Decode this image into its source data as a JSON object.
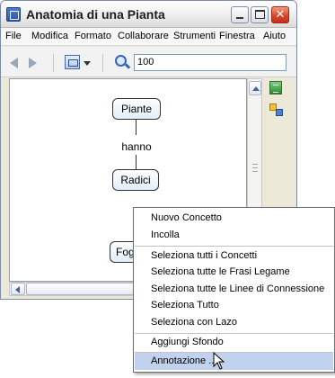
{
  "window": {
    "title": "Anatomia di una Pianta",
    "close_glyph": "✕"
  },
  "menubar": {
    "items": [
      {
        "label": "File"
      },
      {
        "label": "Modifica"
      },
      {
        "label": "Formato"
      },
      {
        "label": "Collaborare"
      },
      {
        "label": "Strumenti"
      },
      {
        "label": "Finestra"
      },
      {
        "label": "Aiuto"
      }
    ]
  },
  "toolbar": {
    "zoom_value": "100",
    "icons": [
      "back-arrow-icon",
      "forward-arrow-icon",
      "view-icon",
      "zoom-icon"
    ]
  },
  "map": {
    "nodes": {
      "piante": "Piante",
      "radici": "Radici",
      "foglie": "Foglie"
    },
    "link_label": "hanno"
  },
  "context_menu": {
    "items": [
      {
        "label": "Nuovo Concetto"
      },
      {
        "label": "Incolla"
      },
      {
        "label": "Seleziona tutti i Concetti"
      },
      {
        "label": "Seleziona tutte le Frasi Legame"
      },
      {
        "label": "Seleziona tutte le Linee di Connessione"
      },
      {
        "label": "Seleziona Tutto"
      },
      {
        "label": "Seleziona con Lazo"
      },
      {
        "label": "Aggiungi Sfondo"
      },
      {
        "label": "Annotazione ..."
      }
    ],
    "highlighted_index": 8
  },
  "colors": {
    "menu_highlight": "#c1d2ee",
    "node_fill": "#e3eef8",
    "close_button": "#d2452a"
  }
}
